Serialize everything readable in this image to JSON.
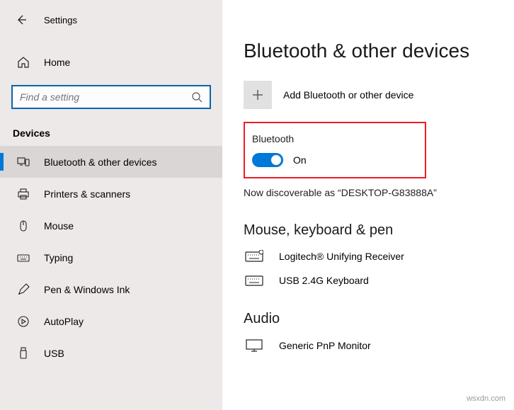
{
  "header": {
    "title": "Settings"
  },
  "home": {
    "label": "Home"
  },
  "search": {
    "placeholder": "Find a setting"
  },
  "section": {
    "label": "Devices"
  },
  "nav": {
    "items": [
      {
        "label": "Bluetooth & other devices"
      },
      {
        "label": "Printers & scanners"
      },
      {
        "label": "Mouse"
      },
      {
        "label": "Typing"
      },
      {
        "label": "Pen & Windows Ink"
      },
      {
        "label": "AutoPlay"
      },
      {
        "label": "USB"
      }
    ]
  },
  "main": {
    "title": "Bluetooth & other devices",
    "add_label": "Add Bluetooth or other device",
    "bluetooth_label": "Bluetooth",
    "toggle_state": "On",
    "discoverable": "Now discoverable as “DESKTOP-G83888A”",
    "sub1": "Mouse, keyboard & pen",
    "devices": [
      {
        "label": "Logitech® Unifying Receiver"
      },
      {
        "label": "USB 2.4G Keyboard"
      }
    ],
    "sub2": "Audio",
    "audio_devices": [
      {
        "label": "Generic PnP Monitor"
      }
    ]
  },
  "watermark": "wsxdn.com"
}
